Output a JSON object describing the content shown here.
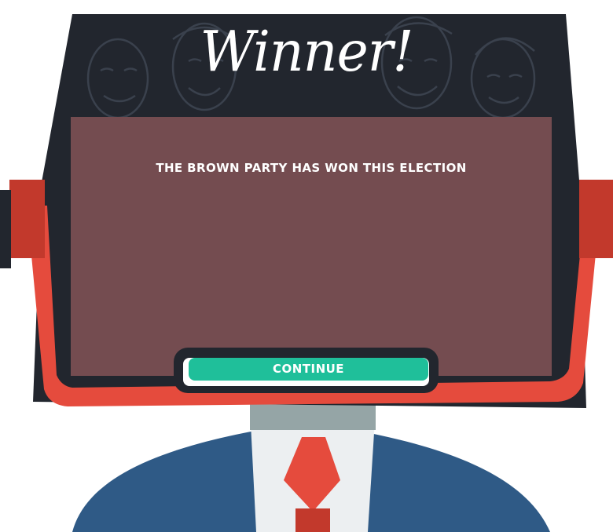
{
  "header": {
    "title": "Winner!"
  },
  "result": {
    "message": "THE BROWN PARTY HAS WON THIS ELECTION"
  },
  "actions": {
    "continue_label": "CONTINUE"
  },
  "colors": {
    "tv_body": "#22262e",
    "screen": "#744c50",
    "frame_red": "#e54b3d",
    "knob_red": "#c2392c",
    "button": "#1fbf9a",
    "suit": "#2f5a86",
    "shirt": "#eceff1",
    "neck": "#95a5a6"
  }
}
